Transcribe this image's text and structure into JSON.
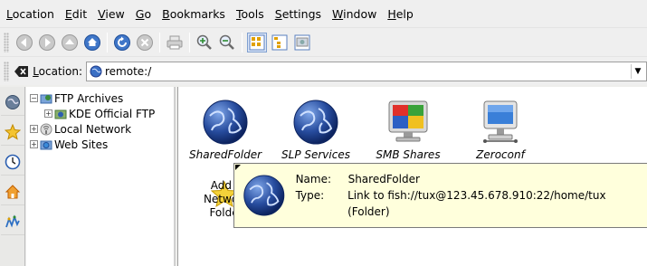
{
  "menubar": {
    "items": [
      {
        "u": "L",
        "rest": "ocation"
      },
      {
        "u": "E",
        "rest": "dit"
      },
      {
        "u": "V",
        "rest": "iew"
      },
      {
        "u": "G",
        "rest": "o"
      },
      {
        "u": "B",
        "rest": "ookmarks"
      },
      {
        "u": "T",
        "rest": "ools"
      },
      {
        "u": "S",
        "rest": "ettings"
      },
      {
        "u": "W",
        "rest": "indow"
      },
      {
        "u": "H",
        "rest": "elp"
      }
    ]
  },
  "locationbar": {
    "label_u": "L",
    "label_rest": "ocation:",
    "value": "remote:/"
  },
  "tree": {
    "items": [
      {
        "label": "FTP Archives"
      },
      {
        "label": "KDE Official FTP"
      },
      {
        "label": "Local Network"
      },
      {
        "label": "Web Sites"
      }
    ]
  },
  "view": {
    "icons": [
      {
        "label": "SharedFolder"
      },
      {
        "label": "SLP Services"
      },
      {
        "label": "SMB Shares"
      },
      {
        "label": "Zeroconf"
      }
    ],
    "add_folder_line1": "Add a",
    "add_folder_line2": "Network Folder"
  },
  "tooltip": {
    "name_key": "Name:",
    "name_value": "SharedFolder",
    "type_key": "Type:",
    "type_value": "Link to fish://tux@123.45.678.910:22/home/tux (Folder)"
  },
  "colors": {
    "globe": "#1f3a8a",
    "tooltip_bg": "#ffffdc"
  }
}
